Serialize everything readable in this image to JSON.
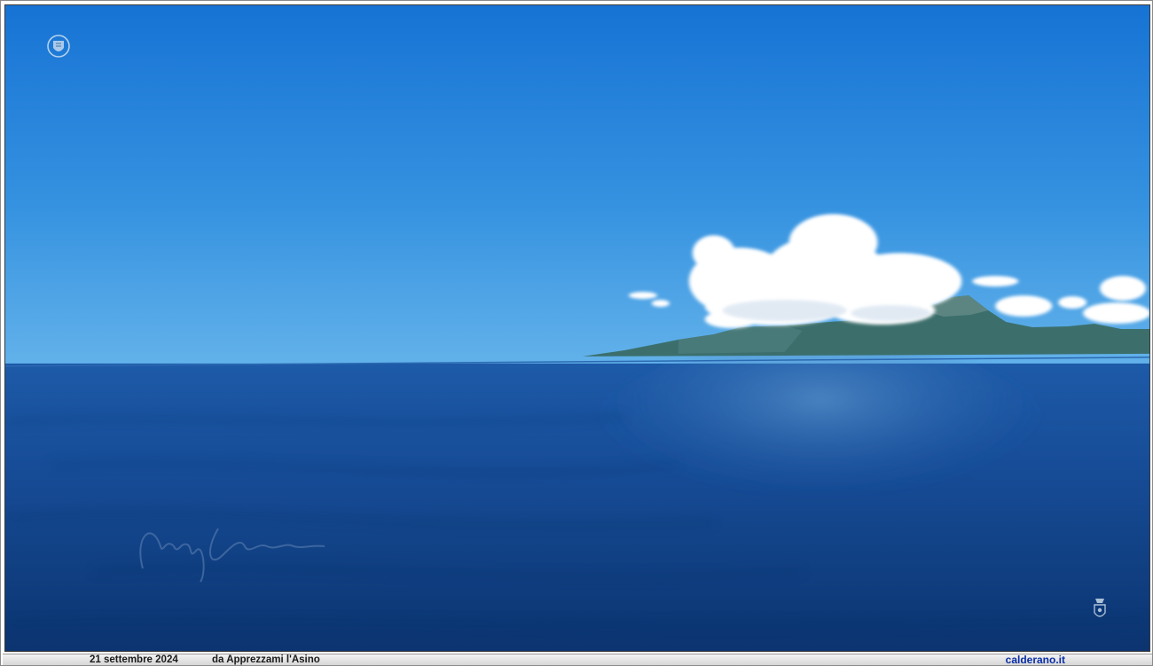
{
  "photo": {
    "subject": "sea-coast-landscape",
    "colors": {
      "sky_top": "#1a78d8",
      "sky_horizon": "#5eaee8",
      "sea_far": "#1c56a4",
      "sea_near": "#0c3a78",
      "cloud": "#ffffff",
      "coast": "#3a6f6a"
    }
  },
  "overlay": {
    "top_logo_icon": "coat-of-arms-icon",
    "bottom_logo_icon": "crest-icon",
    "signature_icon": "signature-icon",
    "signature_text": "Mayo Calderano"
  },
  "caption": {
    "date": "21 settembre 2024",
    "source": "da Apprezzami l'Asino",
    "site": "calderano.it"
  }
}
